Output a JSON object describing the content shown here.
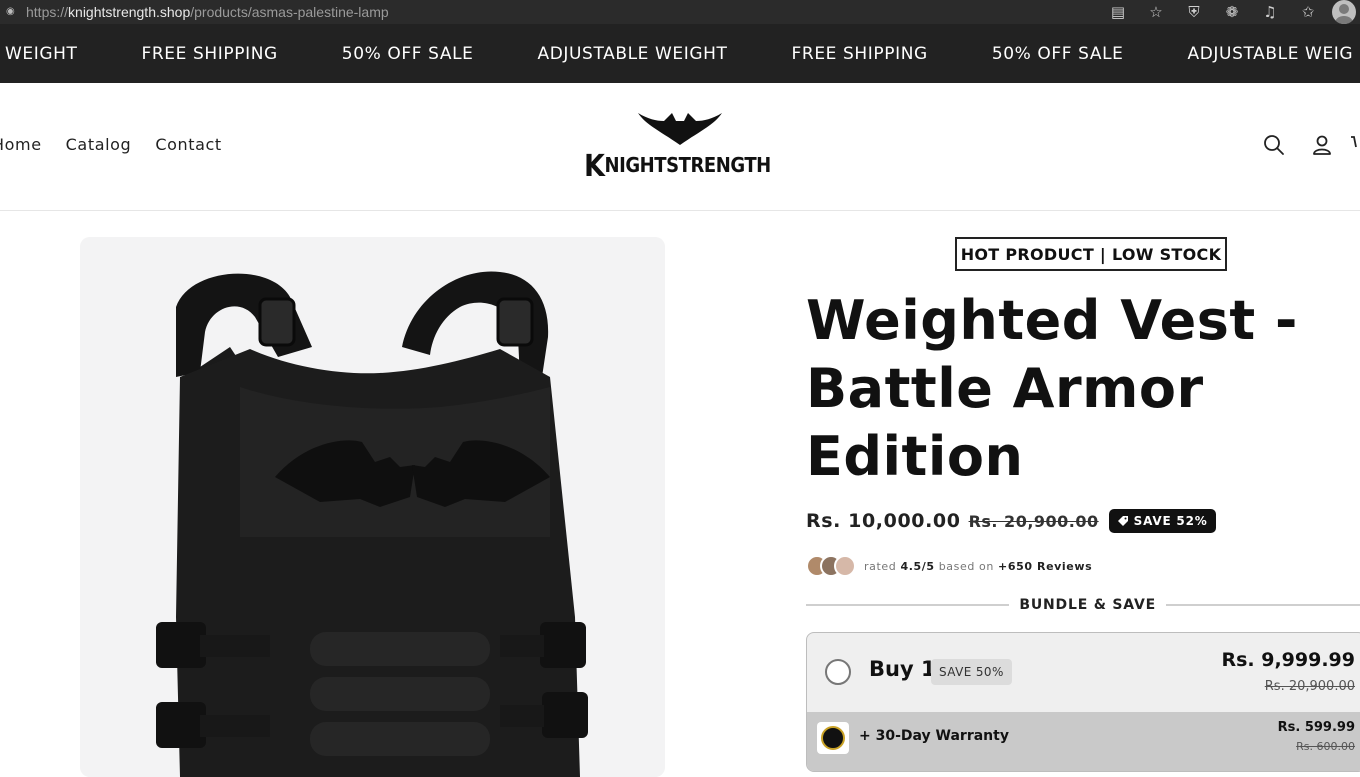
{
  "browser": {
    "url_prefix": "https://",
    "url_host": "knightstrength.shop",
    "url_path": "/products/asmas-palestine-lamp"
  },
  "announcement": {
    "items": [
      "WEIGHT",
      "FREE SHIPPING",
      "50% OFF SALE",
      "ADJUSTABLE WEIGHT",
      "FREE SHIPPING",
      "50% OFF SALE",
      "ADJUSTABLE WEIG"
    ]
  },
  "nav": {
    "items": [
      "Home",
      "Catalog",
      "Contact"
    ]
  },
  "logo": {
    "text_k": "K",
    "text_rest": "NIGHTSTRENGTH"
  },
  "header_icons": [
    "search-icon",
    "account-icon",
    "cart-icon"
  ],
  "product": {
    "badge": "HOT PRODUCT | LOW STOCK",
    "title": "Weighted Vest - Battle Armor Edition",
    "price": "Rs. 10,000.00",
    "compare_price": "Rs. 20,900.00",
    "save_badge": "SAVE 52%",
    "rating_prefix": "rated ",
    "rating_value": "4.5/5",
    "rating_mid": " based on ",
    "rating_count": "+650 Reviews"
  },
  "bundle": {
    "label": "BUNDLE & SAVE",
    "offer": {
      "name": "Buy 1",
      "save": "SAVE 50%",
      "price": "Rs. 9,999.99",
      "compare_price": "Rs. 20,900.00"
    },
    "addon": {
      "name": "+ 30-Day Warranty",
      "price": "Rs. 599.99",
      "compare_price": "Rs. 600.00"
    }
  },
  "colors": {
    "announcement_bg": "#222222",
    "accent": "#111111",
    "media_bg": "#f3f3f4"
  }
}
